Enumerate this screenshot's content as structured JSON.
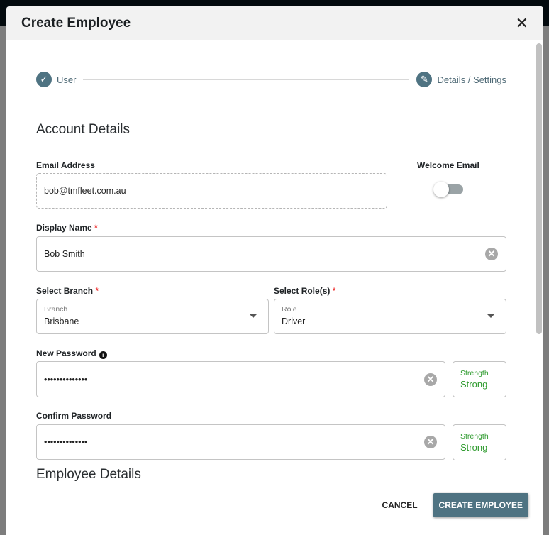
{
  "modal": {
    "title": "Create Employee",
    "close_icon": "close-icon"
  },
  "stepper": {
    "steps": [
      {
        "label": "User",
        "icon": "check-icon"
      },
      {
        "label": "Details / Settings",
        "icon": "pencil-icon"
      }
    ]
  },
  "account": {
    "heading": "Account Details",
    "email": {
      "label": "Email Address",
      "value": "bob@tmfleet.com.au"
    },
    "welcome": {
      "label": "Welcome Email",
      "enabled": false
    },
    "display_name": {
      "label": "Display Name",
      "required": "*",
      "value": "Bob Smith"
    },
    "branch": {
      "label": "Select Branch",
      "required": "*",
      "small": "Branch",
      "value": "Brisbane"
    },
    "role": {
      "label": "Select Role(s)",
      "required": "*",
      "small": "Role",
      "value": "Driver"
    },
    "new_password": {
      "label": "New Password",
      "value": "••••••••••••••",
      "strength_label": "Strength",
      "strength": "Strong"
    },
    "confirm_password": {
      "label": "Confirm Password",
      "value": "••••••••••••••",
      "strength_label": "Strength",
      "strength": "Strong"
    }
  },
  "employee": {
    "heading": "Employee Details"
  },
  "footer": {
    "cancel": "CANCEL",
    "create": "CREATE EMPLOYEE"
  },
  "colors": {
    "accent": "#4f7382",
    "strength": "#2e9b2e",
    "required": "#e33333"
  }
}
